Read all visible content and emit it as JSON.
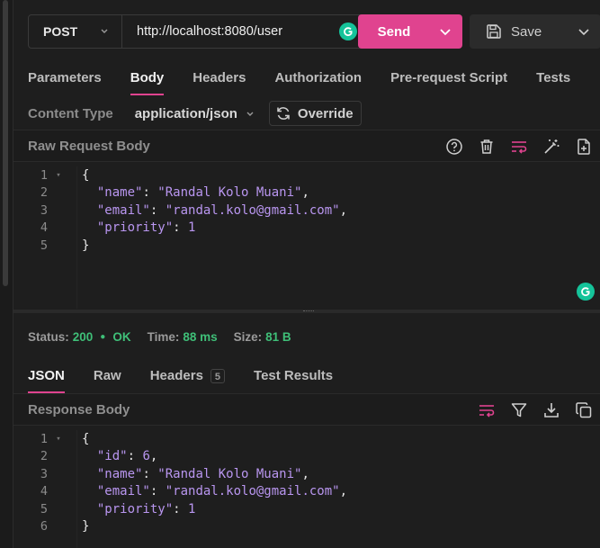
{
  "request": {
    "method": "POST",
    "url": "http://localhost:8080/user",
    "send_label": "Send",
    "save_label": "Save"
  },
  "request_tabs": [
    "Parameters",
    "Body",
    "Headers",
    "Authorization",
    "Pre-request Script",
    "Tests"
  ],
  "active_request_tab": "Body",
  "content_type": {
    "label": "Content Type",
    "value": "application/json",
    "override_label": "Override"
  },
  "raw_body": {
    "title": "Raw Request Body",
    "lines": [
      "1",
      "2",
      "3",
      "4",
      "5"
    ],
    "json": {
      "name_key": "\"name\"",
      "name_val": "\"Randal Kolo Muani\"",
      "email_key": "\"email\"",
      "email_val": "\"randal.kolo@gmail.com\"",
      "priority_key": "\"priority\"",
      "priority_val": "1"
    }
  },
  "status": {
    "status_label": "Status:",
    "code": "200",
    "text": "OK",
    "time_label": "Time:",
    "time": "88 ms",
    "size_label": "Size:",
    "size": "81 B"
  },
  "response_tabs": {
    "json": "JSON",
    "raw": "Raw",
    "headers": "Headers",
    "headers_count": "5",
    "test_results": "Test Results"
  },
  "response_body": {
    "title": "Response Body",
    "lines": [
      "1",
      "2",
      "3",
      "4",
      "5",
      "6"
    ],
    "json": {
      "id_key": "\"id\"",
      "id_val": "6",
      "name_key": "\"name\"",
      "name_val": "\"Randal Kolo Muani\"",
      "email_key": "\"email\"",
      "email_val": "\"randal.kolo@gmail.com\"",
      "priority_key": "\"priority\"",
      "priority_val": "1"
    }
  },
  "colors": {
    "accent": "#e0438f",
    "ok": "#3fbf78",
    "json_value": "#b996f0"
  }
}
